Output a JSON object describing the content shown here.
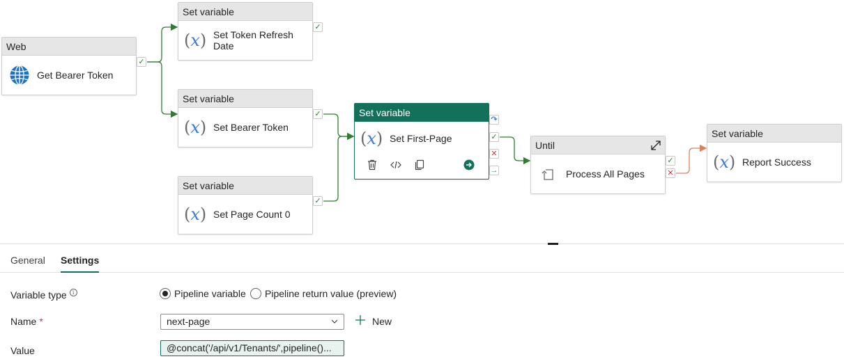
{
  "canvas": {
    "nodes": {
      "web": {
        "type": "Web",
        "name": "Get Bearer Token",
        "icon": "globe-icon"
      },
      "token_refresh": {
        "type": "Set variable",
        "name": "Set Token Refresh Date",
        "icon": "variable-icon"
      },
      "bearer_token": {
        "type": "Set variable",
        "name": "Set Bearer Token",
        "icon": "variable-icon"
      },
      "page_count": {
        "type": "Set variable",
        "name": "Set Page Count 0",
        "icon": "variable-icon"
      },
      "first_page": {
        "type": "Set variable",
        "name": "Set First-Page",
        "icon": "variable-icon"
      },
      "until": {
        "type": "Until",
        "name": "Process All Pages",
        "icon": "loop-icon"
      },
      "report_success": {
        "type": "Set variable",
        "name": "Report Success",
        "icon": "variable-icon"
      }
    },
    "icon_glyph": "x",
    "paren_open": "(",
    "paren_close": ")",
    "port_glyphs": {
      "success": "✓",
      "failure": "✕",
      "skip": "↷",
      "completion": "→"
    },
    "colors": {
      "accent": "#12705b",
      "success": "#2e7d32",
      "failure": "#d13438",
      "failure_wire": "#d9825b"
    }
  },
  "panel": {
    "tabs": [
      {
        "label": "General",
        "active": false
      },
      {
        "label": "Settings",
        "active": true
      }
    ],
    "variable_type": {
      "label": "Variable type",
      "info": "i",
      "options": [
        {
          "label": "Pipeline variable",
          "selected": true
        },
        {
          "label": "Pipeline return value (preview)",
          "selected": false
        }
      ]
    },
    "name": {
      "label": "Name",
      "required_mark": "*",
      "value": "next-page",
      "new_label": "New"
    },
    "value": {
      "label": "Value",
      "value": "@concat('/api/v1/Tenants/',pipeline()..."
    }
  }
}
